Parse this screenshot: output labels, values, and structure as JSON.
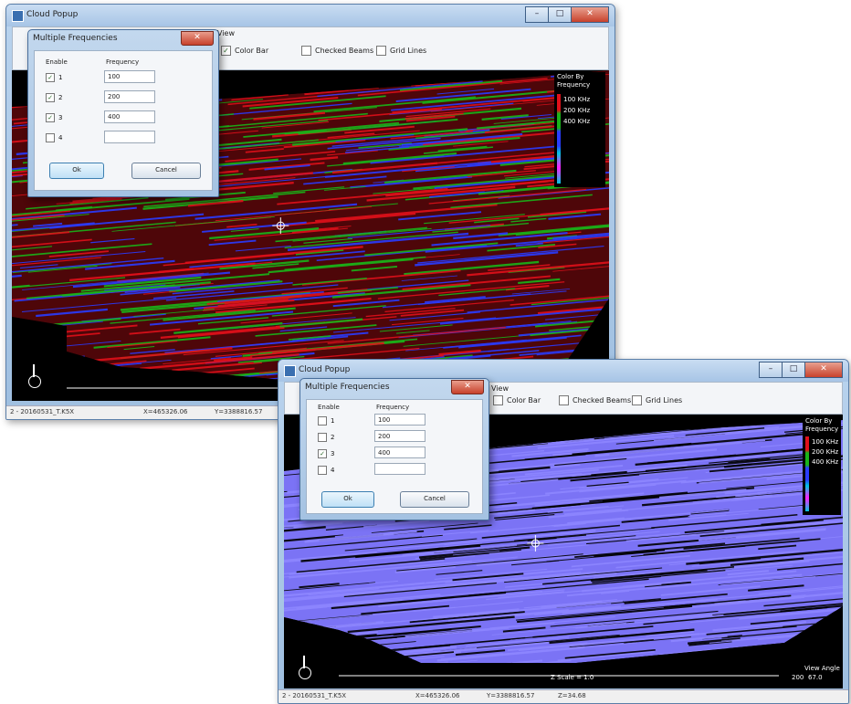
{
  "screenshots": [
    {
      "window": {
        "title": "Cloud Popup"
      },
      "toolbar": {
        "view_label": "View",
        "color_bar": {
          "label": "Color Bar",
          "checked": true
        },
        "checked_beams": {
          "label": "Checked Beams",
          "checked": false
        },
        "grid_lines": {
          "label": "Grid Lines",
          "checked": false
        }
      },
      "legend": {
        "title1": "Color By",
        "title2": "Frequency",
        "entries": [
          {
            "label": "100 KHz",
            "color": "#e0101a"
          },
          {
            "label": "200 KHz",
            "color": "#19b419"
          },
          {
            "label": "400 KHz",
            "color": "#2a3cff"
          }
        ]
      },
      "dialog": {
        "title": "Multiple Frequencies",
        "col_enable": "Enable",
        "col_frequency": "Frequency",
        "rows": [
          {
            "id": "1",
            "enabled": true,
            "frequency": "100"
          },
          {
            "id": "2",
            "enabled": true,
            "frequency": "200"
          },
          {
            "id": "3",
            "enabled": true,
            "frequency": "400"
          },
          {
            "id": "4",
            "enabled": false,
            "frequency": ""
          }
        ],
        "ok": "Ok",
        "cancel": "Cancel"
      },
      "status": {
        "file": "2 - 20160531_T.K5X",
        "x": "X=465326.06",
        "y": "Y=3388816.57"
      },
      "point_colors": [
        "#e0101a",
        "#19b419",
        "#2a3cff"
      ]
    },
    {
      "window": {
        "title": "Cloud Popup"
      },
      "toolbar": {
        "view_label": "View",
        "color_bar": {
          "label": "Color Bar",
          "checked": false
        },
        "checked_beams": {
          "label": "Checked Beams",
          "checked": false
        },
        "grid_lines": {
          "label": "Grid Lines",
          "checked": false
        }
      },
      "legend": {
        "title1": "Color By",
        "title2": "Frequency",
        "entries": [
          {
            "label": "100 KHz",
            "color": "#e0101a"
          },
          {
            "label": "200 KHz",
            "color": "#19b419"
          },
          {
            "label": "400 KHz",
            "color": "#2a3cff"
          }
        ]
      },
      "dialog": {
        "title": "Multiple Frequencies",
        "col_enable": "Enable",
        "col_frequency": "Frequency",
        "rows": [
          {
            "id": "1",
            "enabled": false,
            "frequency": "100"
          },
          {
            "id": "2",
            "enabled": false,
            "frequency": "200"
          },
          {
            "id": "3",
            "enabled": true,
            "frequency": "400"
          },
          {
            "id": "4",
            "enabled": false,
            "frequency": ""
          }
        ],
        "ok": "Ok",
        "cancel": "Cancel"
      },
      "status": {
        "file": "2 - 20160531_T.K5X",
        "x": "X=465326.06",
        "y": "Y=3388816.57",
        "z": "Z=34.68"
      },
      "scale_text": "Z Scale = 1.0",
      "scale_value": "200",
      "view_angle_label": "View Angle",
      "view_angle_value": "67.0",
      "point_colors": [
        "#7b73f5"
      ]
    }
  ]
}
